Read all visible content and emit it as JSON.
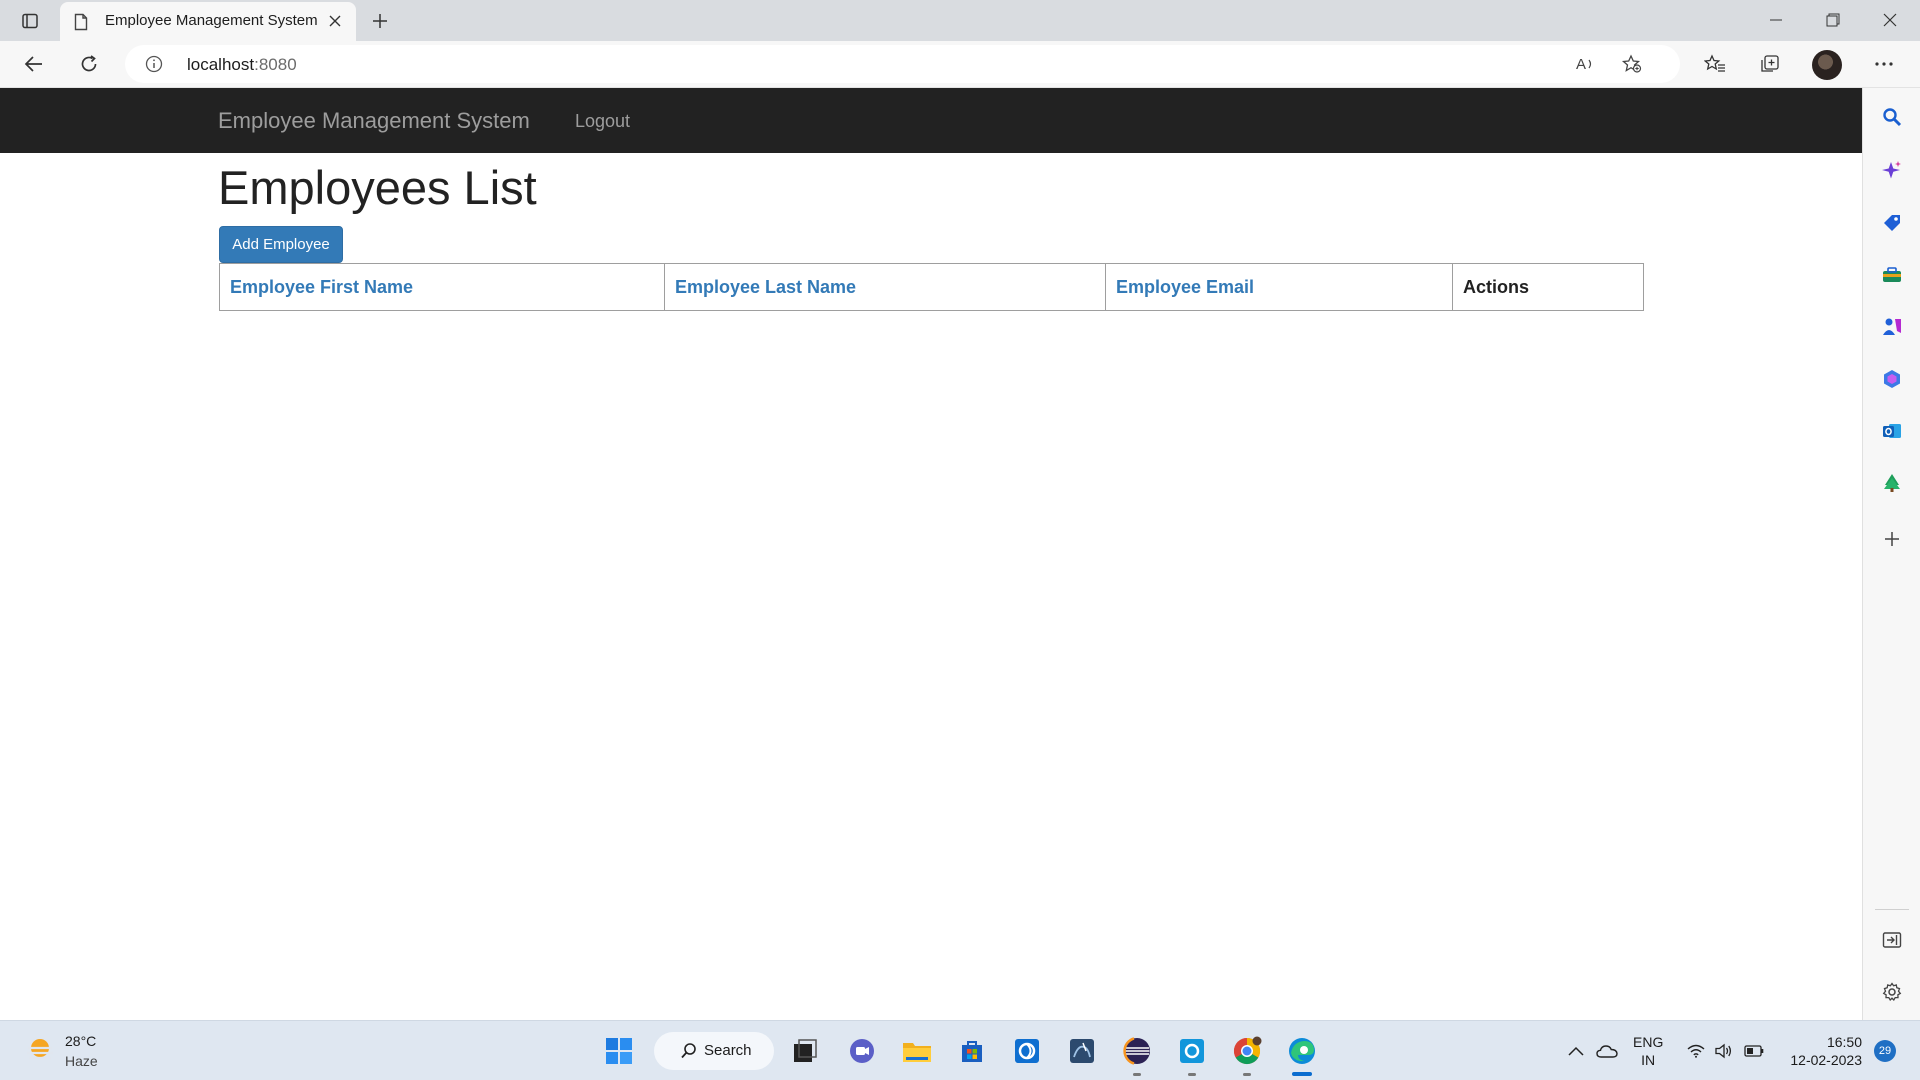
{
  "browser": {
    "tab_title": "Employee Management System",
    "url_host": "localhost",
    "url_port": ":8080"
  },
  "app": {
    "brand": "Employee Management System",
    "logout_label": "Logout",
    "page_title": "Employees List",
    "add_button_label": "Add Employee",
    "table": {
      "headers": [
        "Employee First Name",
        "Employee Last Name",
        "Employee Email",
        "Actions"
      ],
      "rows": []
    }
  },
  "sidebar": {
    "icons": [
      "search-icon",
      "copilot-icon",
      "shopping-tag-icon",
      "tools-icon",
      "games-icon",
      "office-icon",
      "outlook-icon",
      "tree-icon",
      "add-icon",
      "sidebar-toggle-icon",
      "settings-icon"
    ]
  },
  "taskbar": {
    "weather_temp": "28°C",
    "weather_desc": "Haze",
    "search_label": "Search",
    "lang_line1": "ENG",
    "lang_line2": "IN",
    "time": "16:50",
    "date": "12-02-2023",
    "notification_count": "29"
  },
  "colors": {
    "navbar_bg": "#222222",
    "link_blue": "#337ab7",
    "button_blue": "#337ab7"
  }
}
